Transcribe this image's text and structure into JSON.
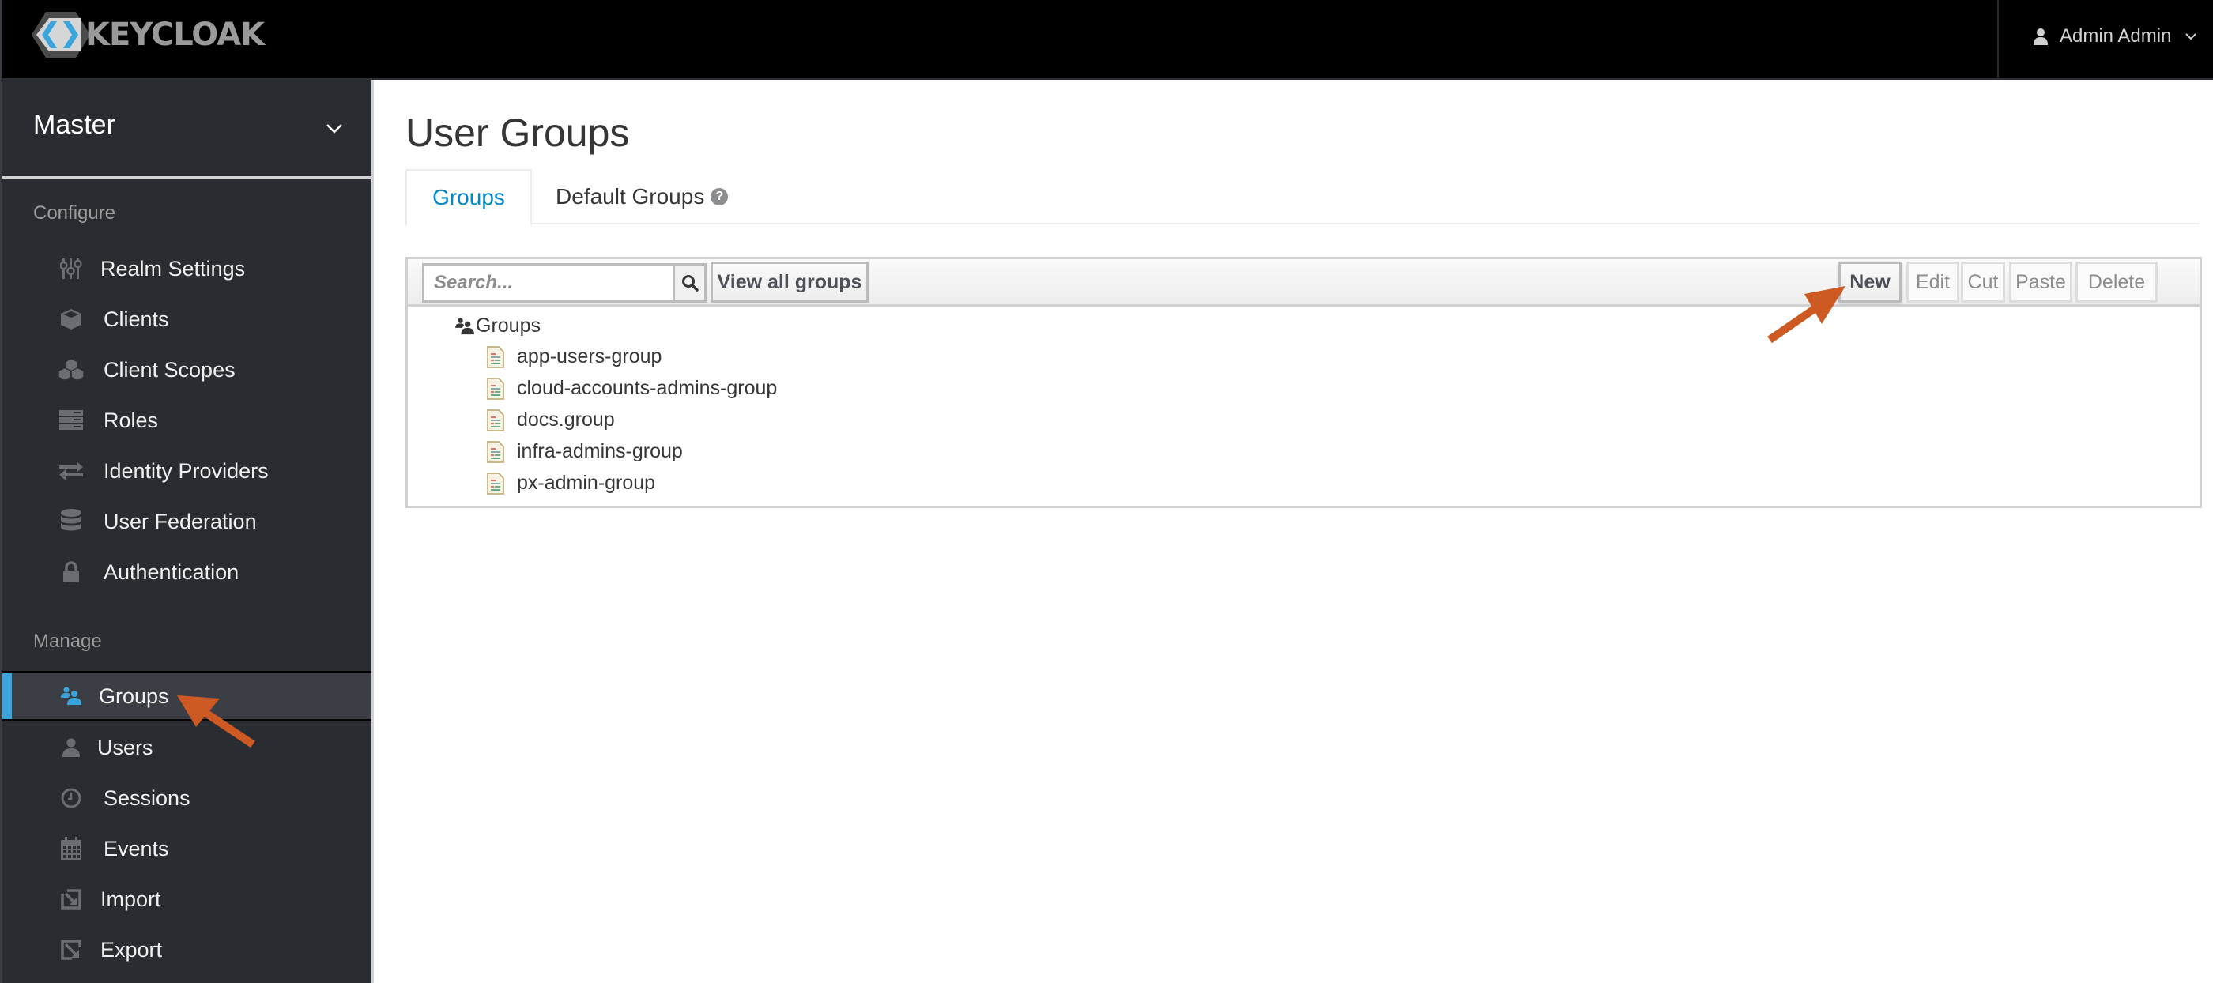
{
  "navbar": {
    "brand": "KEYCLOAK",
    "user_name": "Admin Admin",
    "user_icon": "user-icon",
    "user_menu_icon": "chevron-down-icon"
  },
  "sidebar": {
    "realm": "Master",
    "realm_icon": "chevron-down-icon",
    "sections": [
      {
        "label": "Configure",
        "items": [
          {
            "label": "Realm Settings",
            "icon": "sliders-icon",
            "active": false
          },
          {
            "label": "Clients",
            "icon": "cube-icon",
            "active": false
          },
          {
            "label": "Client Scopes",
            "icon": "cubes-icon",
            "active": false
          },
          {
            "label": "Roles",
            "icon": "server-icon",
            "active": false
          },
          {
            "label": "Identity Providers",
            "icon": "exchange-icon",
            "active": false
          },
          {
            "label": "User Federation",
            "icon": "database-icon",
            "active": false
          },
          {
            "label": "Authentication",
            "icon": "lock-icon",
            "active": false
          }
        ]
      },
      {
        "label": "Manage",
        "items": [
          {
            "label": "Groups",
            "icon": "users-icon",
            "active": true
          },
          {
            "label": "Users",
            "icon": "user-icon",
            "active": false
          },
          {
            "label": "Sessions",
            "icon": "clock-icon",
            "active": false
          },
          {
            "label": "Events",
            "icon": "calendar-icon",
            "active": false
          },
          {
            "label": "Import",
            "icon": "import-icon",
            "active": false
          },
          {
            "label": "Export",
            "icon": "export-icon",
            "active": false
          }
        ]
      }
    ]
  },
  "main": {
    "title": "User Groups",
    "tabs": [
      {
        "label": "Groups",
        "active": true
      },
      {
        "label": "Default Groups",
        "active": false,
        "help_icon": "question-circle-icon",
        "help_glyph": "?"
      }
    ],
    "toolbar": {
      "search_placeholder": "Search...",
      "search_value": "",
      "search_icon": "search-icon",
      "view_all_label": "View all groups",
      "actions": [
        {
          "label": "New",
          "enabled": true
        },
        {
          "label": "Edit",
          "enabled": false
        },
        {
          "label": "Cut",
          "enabled": false
        },
        {
          "label": "Paste",
          "enabled": false
        },
        {
          "label": "Delete",
          "enabled": false
        }
      ]
    },
    "tree": {
      "root_label": "Groups",
      "root_icon": "users-icon",
      "item_icon": "document-icon",
      "items": [
        "app-users-group",
        "cloud-accounts-admins-group",
        "docs.group",
        "infra-admins-group",
        "px-admin-group"
      ]
    }
  },
  "annotations": {
    "arrow_color": "#cc5a22",
    "targets": [
      "sidebar Groups item",
      "New button"
    ]
  },
  "colors": {
    "navbar_bg": "#000000",
    "sidebar_bg": "#292c31",
    "active_accent": "#39a5dc",
    "link_blue": "#0088ce"
  }
}
